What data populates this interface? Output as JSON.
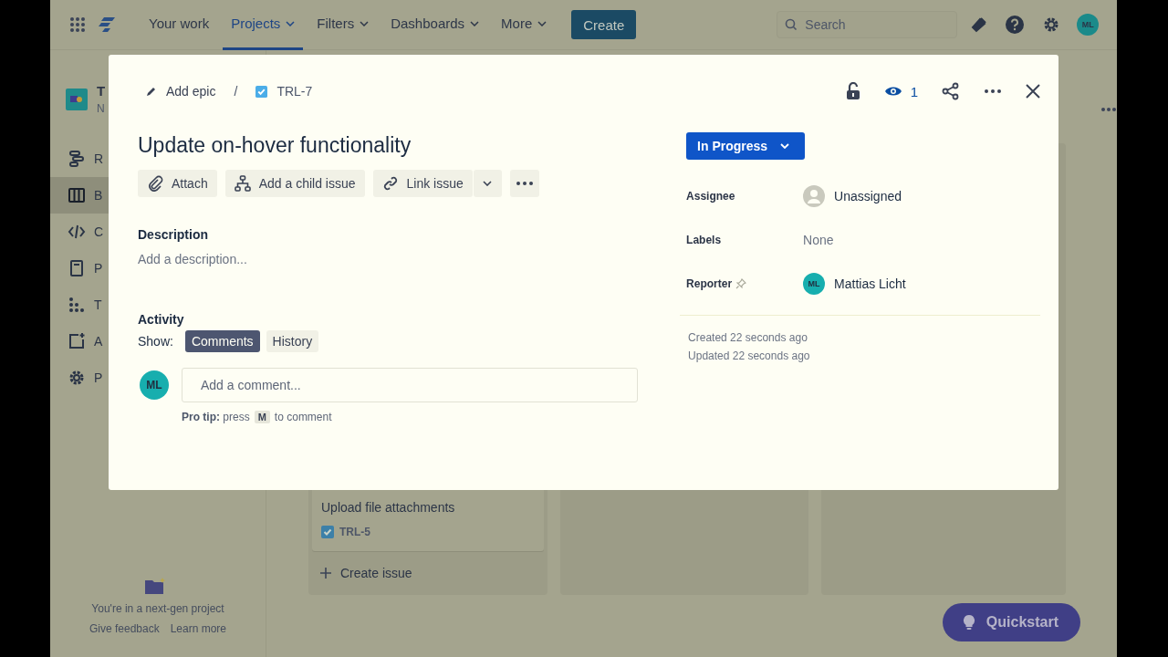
{
  "top_nav": {
    "items": [
      {
        "label": "Your work",
        "selected": false,
        "menu": false
      },
      {
        "label": "Projects",
        "selected": true,
        "menu": true
      },
      {
        "label": "Filters",
        "selected": false,
        "menu": true
      },
      {
        "label": "Dashboards",
        "selected": false,
        "menu": true
      },
      {
        "label": "More",
        "selected": false,
        "menu": true
      }
    ],
    "create": "Create",
    "search": {
      "placeholder": "Search"
    },
    "avatar": "ML"
  },
  "sidebar": {
    "project": {
      "name": "T",
      "subtitle": "N"
    },
    "items": [
      {
        "label": "R",
        "kind": "roadmap",
        "selected": false
      },
      {
        "label": "B",
        "kind": "board",
        "selected": true
      },
      {
        "label": "C",
        "kind": "code",
        "selected": false
      },
      {
        "label": "P",
        "kind": "pages",
        "selected": false
      },
      {
        "label": "T",
        "kind": "tree",
        "selected": false
      },
      {
        "label": "A",
        "kind": "add",
        "selected": false
      },
      {
        "label": "P",
        "kind": "settings",
        "selected": false
      }
    ],
    "footer": {
      "text": "You're in a next-gen project",
      "links": [
        "Give feedback",
        "Learn more"
      ]
    }
  },
  "board": {
    "card": {
      "title": "Upload file attachments",
      "key": "TRL-5"
    },
    "create_issue": "Create issue"
  },
  "quickstart": "Quickstart",
  "modal": {
    "breadcrumb": {
      "epic": "Add epic",
      "separator": "/",
      "key": "TRL-7"
    },
    "watchers": "1",
    "title": "Update on-hover functionality",
    "actions": [
      {
        "label": "Attach",
        "kind": "attach"
      },
      {
        "label": "Add a child issue",
        "kind": "child"
      },
      {
        "label": "Link issue",
        "kind": "link"
      }
    ],
    "description": {
      "label": "Description",
      "placeholder": "Add a description..."
    },
    "activity": {
      "label": "Activity",
      "show_label": "Show:",
      "filters": [
        {
          "label": "Comments",
          "selected": true
        },
        {
          "label": "History",
          "selected": false
        }
      ],
      "comment": {
        "avatar": "ML",
        "placeholder": "Add a comment..."
      },
      "pro_tip": {
        "lead": "**Pro tip:** press",
        "key": "M",
        "tail": "to comment"
      }
    },
    "status": "In Progress",
    "fields": [
      {
        "label": "Assignee",
        "kind": "unassigned",
        "value": "Unassigned",
        "pin": false
      },
      {
        "label": "Labels",
        "kind": "empty",
        "value": "None",
        "pin": false
      },
      {
        "label": "Reporter",
        "kind": "user",
        "avatar": "ML",
        "value": "Mattias Licht",
        "pin": true
      }
    ],
    "created": "Created 22 seconds ago",
    "updated": "Updated 22 seconds ago"
  }
}
